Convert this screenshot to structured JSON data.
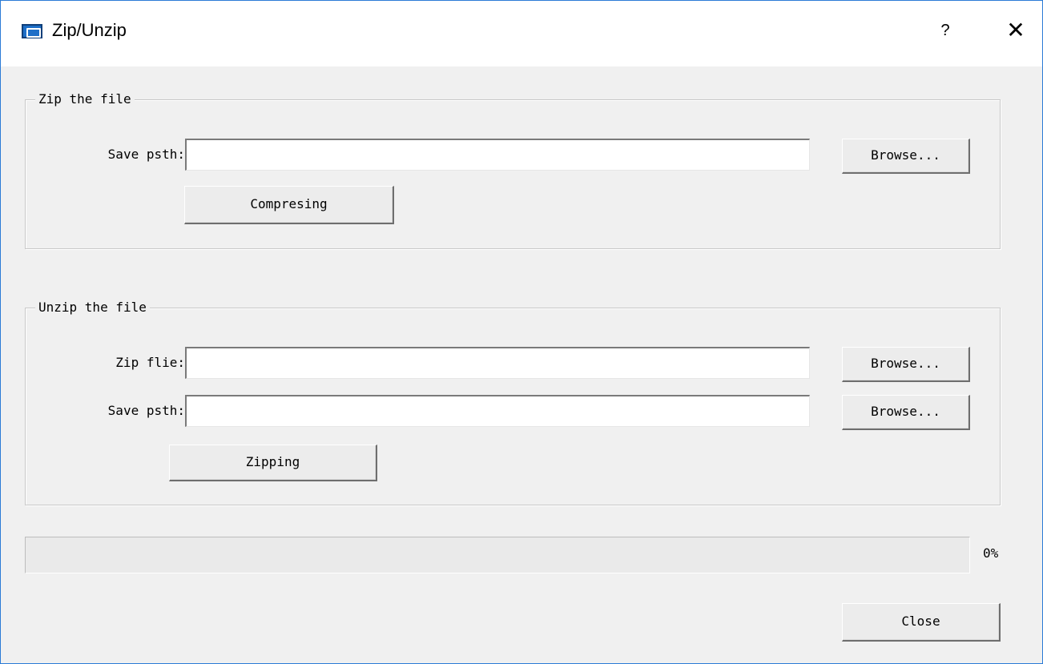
{
  "window": {
    "title": "Zip/Unzip",
    "help_label": "?",
    "close_label": "✕"
  },
  "zip_group": {
    "legend": "Zip the file",
    "save_path_label": "Save psth:",
    "save_path_value": "",
    "browse_label": "Browse...",
    "action_label": "Compresing"
  },
  "unzip_group": {
    "legend": "Unzip the file",
    "zip_file_label": "Zip flie:",
    "zip_file_value": "",
    "zip_browse_label": "Browse...",
    "save_path_label": "Save psth:",
    "save_path_value": "",
    "save_browse_label": "Browse...",
    "action_label": "Zipping"
  },
  "progress": {
    "value": 0,
    "percent_label": "0%"
  },
  "footer": {
    "close_label": "Close"
  }
}
